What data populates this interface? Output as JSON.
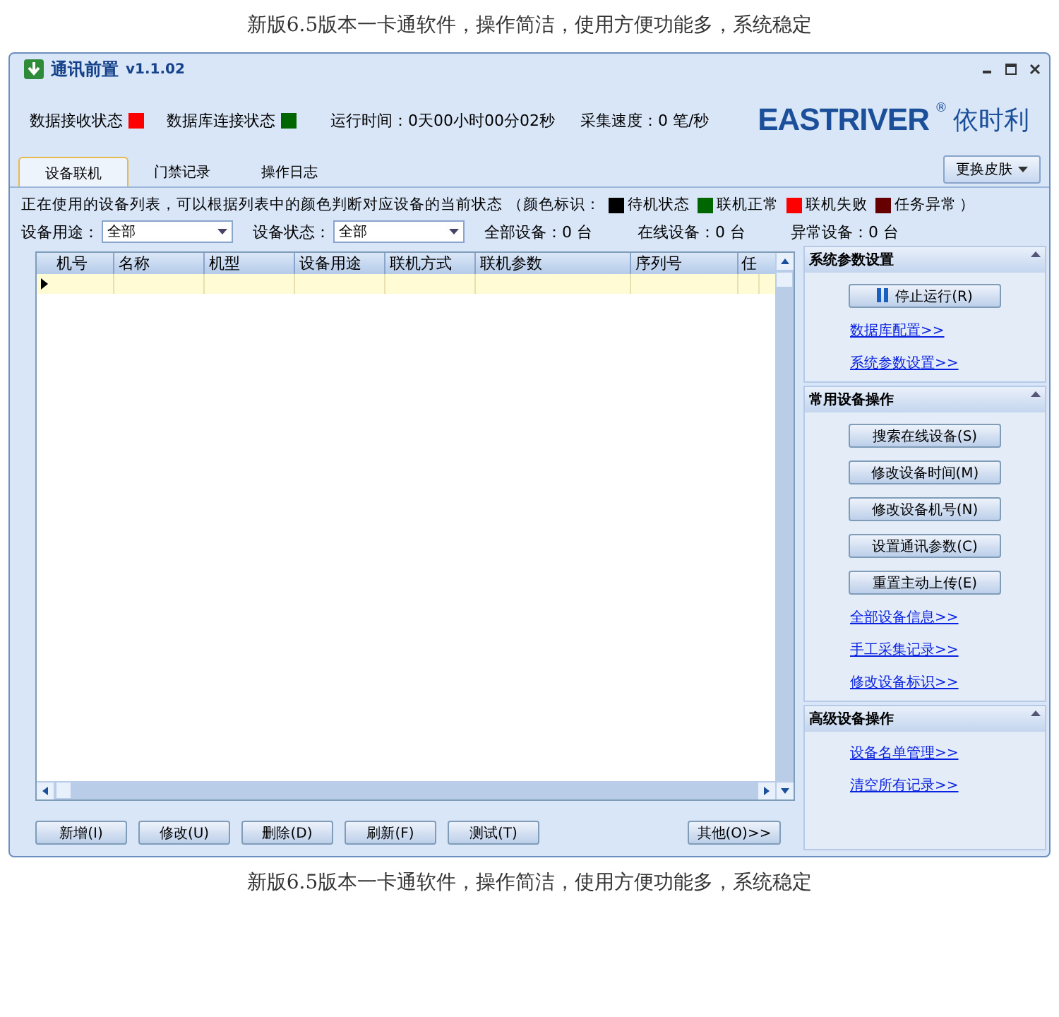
{
  "caption_top": "新版6.5版本一卡通软件，操作简洁，使用方便功能多，系统稳定",
  "window": {
    "title": "通讯前置",
    "version": "v1.1.02"
  },
  "status": [
    {
      "label": "数据接收状态",
      "color": "#ff0000"
    },
    {
      "label": "数据库连接状态",
      "color": "#006600"
    }
  ],
  "runtime": "运行时间：0天00小时00分02秒",
  "speed": "采集速度：0 笔/秒",
  "logo": {
    "brand": "EASTRIVER",
    "mark": "®",
    "cn": "依时利"
  },
  "tabs": [
    {
      "label": "设备联机",
      "selected": true
    },
    {
      "label": "门禁记录",
      "selected": false
    },
    {
      "label": "操作日志",
      "selected": false
    }
  ],
  "skin_button": "更换皮肤",
  "legend_intro": "正在使用的设备列表，可以根据列表中的颜色判断对应设备的当前状态 （颜色标识：",
  "legend": [
    {
      "label": "待机状态",
      "color": "#000000"
    },
    {
      "label": "联机正常",
      "color": "#006600"
    },
    {
      "label": "联机失败",
      "color": "#ff0000"
    },
    {
      "label": "任务异常",
      "color": "#660000"
    }
  ],
  "legend_end": "）",
  "filters": [
    {
      "label": "设备用途：",
      "value": "全部"
    },
    {
      "label": "设备状态：",
      "value": "全部"
    }
  ],
  "counts": [
    "全部设备：0 台",
    "在线设备：0 台",
    "异常设备：0 台"
  ],
  "table": {
    "columns": [
      "机号",
      "名称",
      "机型",
      "设备用途",
      "联机方式",
      "联机参数",
      "序列号",
      "任"
    ]
  },
  "buttons": [
    "新增(I)",
    "修改(U)",
    "删除(D)",
    "刷新(F)",
    "测试(T)"
  ],
  "other_button": "其他(O)>>",
  "panels": [
    {
      "title": "系统参数设置",
      "items": [
        {
          "kind": "button",
          "label": "停止运行(R)",
          "icon": true
        },
        {
          "kind": "link",
          "label": "数据库配置>>"
        },
        {
          "kind": "link",
          "label": "系统参数设置>>"
        }
      ]
    },
    {
      "title": "常用设备操作",
      "items": [
        {
          "kind": "button",
          "label": "搜索在线设备(S)"
        },
        {
          "kind": "button",
          "label": "修改设备时间(M)"
        },
        {
          "kind": "button",
          "label": "修改设备机号(N)"
        },
        {
          "kind": "button",
          "label": "设置通讯参数(C)"
        },
        {
          "kind": "button",
          "label": "重置主动上传(E)"
        },
        {
          "kind": "link",
          "label": "全部设备信息>>"
        },
        {
          "kind": "link",
          "label": "手工采集记录>>"
        },
        {
          "kind": "link",
          "label": "修改设备标识>>"
        }
      ]
    },
    {
      "title": "高级设备操作",
      "items": [
        {
          "kind": "link",
          "label": "设备名单管理>>"
        },
        {
          "kind": "link",
          "label": "清空所有记录>>"
        }
      ]
    }
  ],
  "caption_bottom": "新版6.5版本一卡通软件，操作简洁，使用方便功能多，系统稳定"
}
